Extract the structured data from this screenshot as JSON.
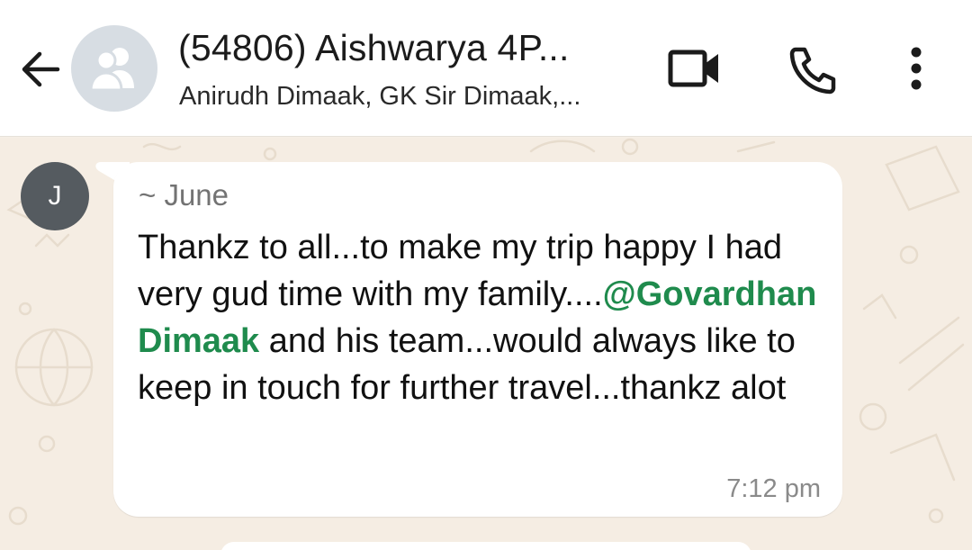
{
  "header": {
    "title": "(54806) Aishwarya  4P...",
    "subtitle": "Anirudh Dimaak, GK Sir Dimaak,...",
    "icons": {
      "back": "arrow-left-icon",
      "avatar": "group-icon",
      "video": "video-call-icon",
      "call": "phone-icon",
      "menu": "more-vert-icon"
    }
  },
  "message": {
    "avatar_initial": "J",
    "sender": "~ June",
    "text_part1": "Thankz to all...to make my trip happy I had very gud time with my family....",
    "mention": "@Govardhan Dimaak",
    "text_part2": "  and his team...would always like to keep in touch for further travel...thankz alot",
    "time": "7:12 pm"
  },
  "colors": {
    "chat_background": "#f5ede3",
    "bubble": "#ffffff",
    "mention": "#1f8b4d",
    "avatar_background": "#555b60",
    "group_avatar_background": "#d7dde3"
  }
}
